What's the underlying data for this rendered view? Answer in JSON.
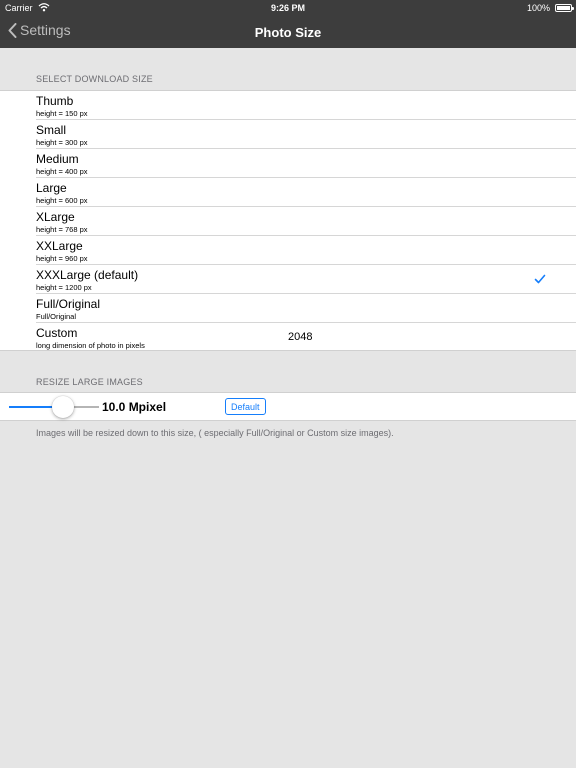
{
  "status_bar": {
    "carrier": "Carrier",
    "time": "9:26 PM",
    "battery": "100%",
    "battery_level": 1.0
  },
  "nav": {
    "back_label": "Settings",
    "title": "Photo Size"
  },
  "download_size": {
    "header": "SELECT DOWNLOAD SIZE",
    "items": [
      {
        "label": "Thumb",
        "sub": "height = 150 px",
        "selected": false
      },
      {
        "label": "Small",
        "sub": "height = 300 px",
        "selected": false
      },
      {
        "label": "Medium",
        "sub": "height = 400 px",
        "selected": false
      },
      {
        "label": "Large",
        "sub": "height = 600 px",
        "selected": false
      },
      {
        "label": "XLarge",
        "sub": "height = 768 px",
        "selected": false
      },
      {
        "label": "XXLarge",
        "sub": "height = 960 px",
        "selected": false
      },
      {
        "label": "XXXLarge (default)",
        "sub": "height = 1200 px",
        "selected": true
      },
      {
        "label": "Full/Original",
        "sub": "Full/Original",
        "selected": false
      },
      {
        "label": "Custom",
        "sub": "long dimension of photo in pixels",
        "value": "2048",
        "selected": false
      }
    ]
  },
  "resize": {
    "header": "RESIZE LARGE IMAGES",
    "slider_fraction": 0.6,
    "value_label": "10.0 Mpixel",
    "default_button": "Default",
    "footnote": "Images will be resized down to this size, ( especially Full/Original or Custom size images)."
  },
  "colors": {
    "accent": "#157efb",
    "bar": "#3d3d3d",
    "background": "#e5e5e5"
  }
}
